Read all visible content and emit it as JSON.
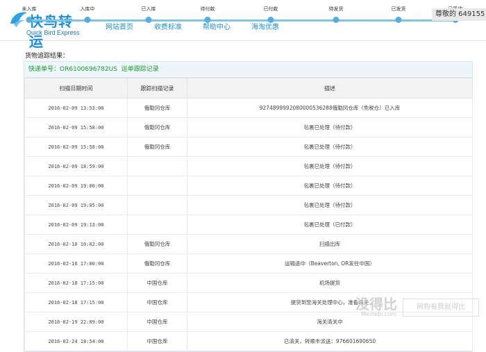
{
  "header": {
    "logo_cn": "快鸟转运",
    "logo_en": "Quick Bird Express",
    "greeting": "尊敬的 649155",
    "steps": [
      "未入库",
      "入库中",
      "已入库",
      "待付款",
      "已付款",
      "待发货",
      "已发货",
      "已签收"
    ],
    "nav": [
      "网站首页",
      "收费标准",
      "帮助中心",
      "海淘优惠"
    ]
  },
  "result_title": "货物追踪结果：",
  "tracking": {
    "label": "快递单号：",
    "number": "OR6100696782US",
    "link": "运单跟踪记录"
  },
  "table": {
    "headers": [
      "扫描日期时间",
      "跟踪扫描记录",
      "描述"
    ],
    "rows": [
      {
        "time": "2016-02-09 13:53:00",
        "loc": "俄勒冈仓库",
        "desc": "9274899992080000536288俄勒冈仓库（免税仓）已入库"
      },
      {
        "time": "2016-02-09 15:58:00",
        "loc": "俄勒冈仓库",
        "desc": "包裹已处理（待付款）"
      },
      {
        "time": "2016-02-09 15:58:00",
        "loc": "俄勒冈仓库",
        "desc": "包裹已处理（待付款）"
      },
      {
        "time": "2016-02-09 18:59:00",
        "loc": "",
        "desc": "包裹已处理（待付款）"
      },
      {
        "time": "2016-02-09 19:00:00",
        "loc": "",
        "desc": "包裹已处理（待付款）"
      },
      {
        "time": "2016-02-09 19:05:00",
        "loc": "",
        "desc": "包裹已处理（待付款）"
      },
      {
        "time": "2016-02-09 19:13:00",
        "loc": "",
        "desc": "包裹已处理（已付款）"
      },
      {
        "time": "2016-02-10 10:02:00",
        "loc": "俄勒冈仓库",
        "desc": "扫描出库"
      },
      {
        "time": "2016-02-16 17:00:00",
        "loc": "俄勒冈仓库",
        "desc": "运输途中（Beaverton, OR发往中国）"
      },
      {
        "time": "2016-02-18 17:15:00",
        "loc": "中国仓库",
        "desc": "机场提货"
      },
      {
        "time": "2016-02-18 17:15:00",
        "loc": "中国仓库",
        "desc": "提货到至海关处理中心，准备清关"
      },
      {
        "time": "2016-02-19 22:09:00",
        "loc": "中国仓库",
        "desc": "海关清关中"
      },
      {
        "time": "2016-02-24 18:54:00",
        "loc": "中国仓库",
        "desc": "已清关，转顺丰派送：976601690650"
      }
    ]
  },
  "watermark": {
    "main": "没得比",
    "sub": "Meidebi.com",
    "slogan": "网购有我就得比"
  }
}
